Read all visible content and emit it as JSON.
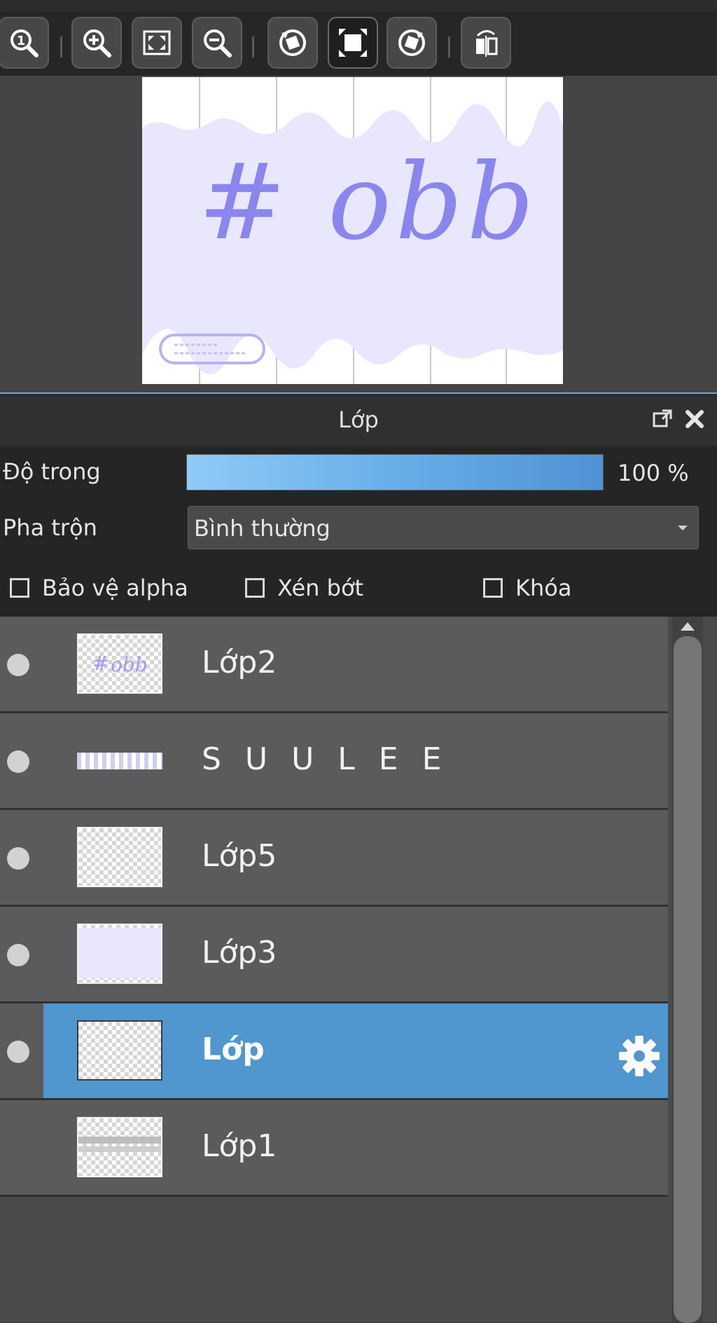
{
  "toolbar": {
    "buttons": [
      {
        "name": "zoom-actual-size-icon"
      },
      {
        "name": "zoom-in-icon"
      },
      {
        "name": "fit-to-screen-icon"
      },
      {
        "name": "zoom-out-icon"
      },
      {
        "name": "rotate-left-icon"
      },
      {
        "name": "canvas-fit-icon"
      },
      {
        "name": "rotate-right-icon"
      },
      {
        "name": "flip-horizontal-icon"
      }
    ]
  },
  "navigator": {
    "artwork_text": "# obb"
  },
  "layer_panel": {
    "title": "Lớp",
    "opacity_label": "Độ trong",
    "opacity_value": "100 %",
    "opacity_fraction": 1.0,
    "blend_label": "Pha trộn",
    "blend_value": "Bình thường",
    "checkboxes": [
      {
        "label": "Bảo vệ alpha",
        "checked": false
      },
      {
        "label": "Xén bớt",
        "checked": false
      },
      {
        "label": "Khóa",
        "checked": false
      }
    ]
  },
  "layers": [
    {
      "name": "Lớp2",
      "visible": true,
      "selected": false
    },
    {
      "name": "S U U L E E",
      "visible": true,
      "selected": false
    },
    {
      "name": "Lớp5",
      "visible": true,
      "selected": false
    },
    {
      "name": "Lớp3",
      "visible": true,
      "selected": false
    },
    {
      "name": "Lớp",
      "visible": true,
      "selected": true
    },
    {
      "name": "Lớp1",
      "visible": false,
      "selected": false
    }
  ],
  "colors": {
    "selection": "#5096cf",
    "opacity_fill": "#67aee9",
    "artwork_purple": "#8a86ee"
  }
}
